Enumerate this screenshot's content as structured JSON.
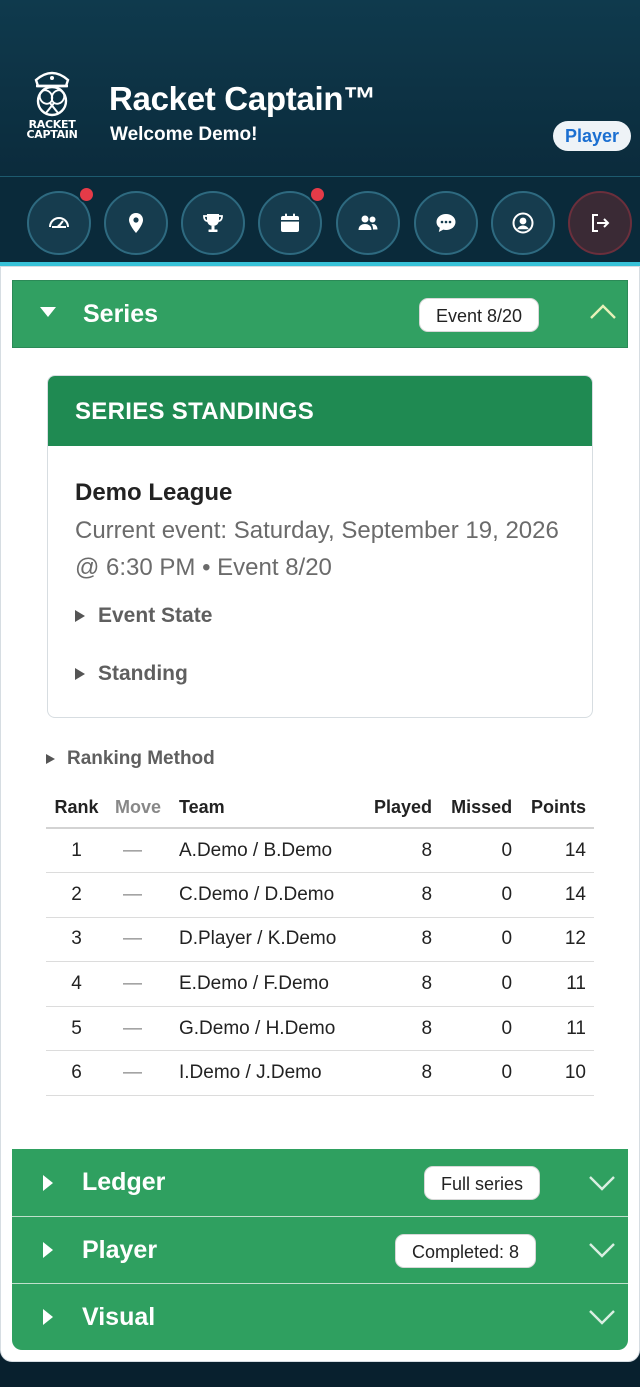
{
  "header": {
    "logo_text_line1": "RACKET",
    "logo_text_line2": "CAPTAIN",
    "app_title": "Racket Captain™",
    "welcome": "Welcome Demo!",
    "role_badge": "Player"
  },
  "nav": {
    "items": [
      {
        "icon": "gauge-icon",
        "notification": true
      },
      {
        "icon": "map-pin-icon",
        "notification": false
      },
      {
        "icon": "trophy-icon",
        "notification": false
      },
      {
        "icon": "calendar-icon",
        "notification": true
      },
      {
        "icon": "users-icon",
        "notification": false
      },
      {
        "icon": "chat-icon",
        "notification": false
      },
      {
        "icon": "user-circle-icon",
        "notification": false
      },
      {
        "icon": "logout-icon",
        "notification": false
      }
    ],
    "colors": {
      "notification_dot": "#e53b48",
      "accent_border": "#38c2d8"
    }
  },
  "series_section": {
    "title": "Series",
    "pill": "Event 8/20",
    "standings": {
      "heading": "SERIES STANDINGS",
      "league_name": "Demo League",
      "current_event": "Current event: Saturday, September 19, 2026 @ 6:30 PM • Event 8/20",
      "event_state_label": "Event State",
      "standing_label": "Standing"
    },
    "ranking_method_label": "Ranking Method",
    "table": {
      "columns": [
        "Rank",
        "Move",
        "Team",
        "Played",
        "Missed",
        "Points"
      ],
      "rows": [
        {
          "rank": "1",
          "move": "—",
          "team": "A.Demo / B.Demo",
          "played": "8",
          "missed": "0",
          "points": "14"
        },
        {
          "rank": "2",
          "move": "—",
          "team": "C.Demo / D.Demo",
          "played": "8",
          "missed": "0",
          "points": "14"
        },
        {
          "rank": "3",
          "move": "—",
          "team": "D.Player / K.Demo",
          "played": "8",
          "missed": "0",
          "points": "12"
        },
        {
          "rank": "4",
          "move": "—",
          "team": "E.Demo / F.Demo",
          "played": "8",
          "missed": "0",
          "points": "11"
        },
        {
          "rank": "5",
          "move": "—",
          "team": "G.Demo / H.Demo",
          "played": "8",
          "missed": "0",
          "points": "11"
        },
        {
          "rank": "6",
          "move": "—",
          "team": "I.Demo / J.Demo",
          "played": "8",
          "missed": "0",
          "points": "10"
        }
      ]
    }
  },
  "ledger_section": {
    "title": "Ledger",
    "pill": "Full series"
  },
  "player_section": {
    "title": "Player",
    "pill": "Completed: 8"
  },
  "visual_section": {
    "title": "Visual"
  },
  "colors": {
    "section_green": "#2fa060",
    "standings_green": "#1f8a52",
    "role_blue": "#1b6fd1"
  }
}
